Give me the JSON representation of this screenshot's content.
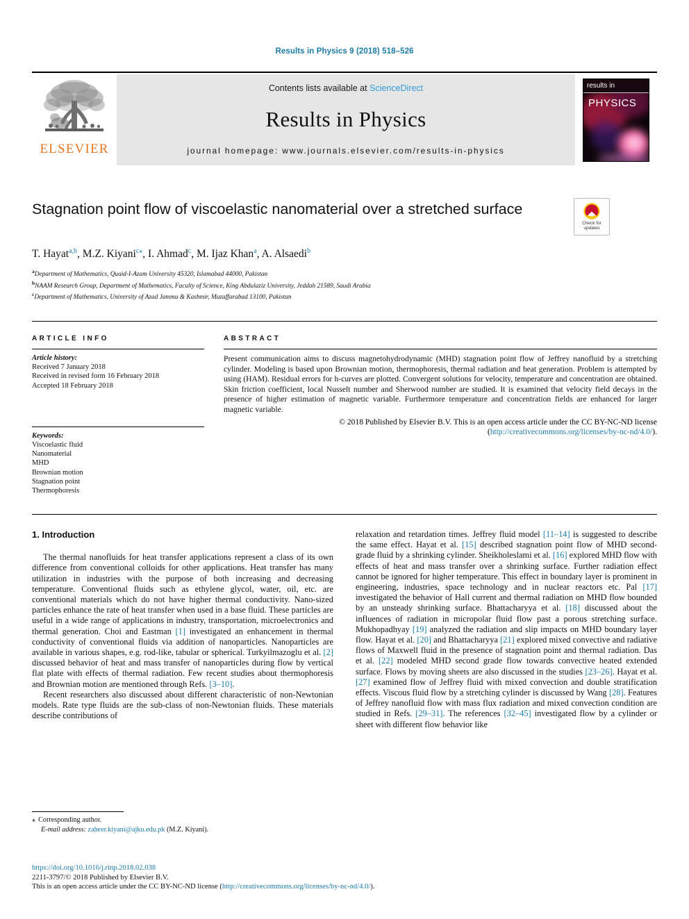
{
  "running_head": "Results in Physics 9 (2018) 518–526",
  "masthead": {
    "publisher_name": "ELSEVIER",
    "contents_prefix": "Contents lists available at ",
    "contents_link": "ScienceDirect",
    "journal_title": "Results in Physics",
    "homepage": "journal homepage: www.journals.elsevier.com/results-in-physics",
    "cover": {
      "line1": "results in",
      "line2": "PHYSICS"
    }
  },
  "article": {
    "title": "Stagnation point flow of viscoelastic nanomaterial over a stretched surface",
    "crossmark_line1": "Check for",
    "crossmark_line2": "updates",
    "authors_html": "T. Hayat<sup>a,b</sup>, M.Z. Kiyani<sup>c</sup><sup class=\"star\">⁎</sup>, I. Ahmad<sup>c</sup>, M. Ijaz Khan<sup>a</sup>, A. Alsaedi<sup>b</sup>",
    "affiliations": [
      {
        "mark": "a",
        "text": "Department of Mathematics, Quaid-I-Azam University 45320, Islamabad 44000, Pakistan"
      },
      {
        "mark": "b",
        "text": "NAAM Research Group, Department of Mathematics, Faculty of Science, King Abdulaziz University, Jeddah 21589, Saudi Arabia"
      },
      {
        "mark": "c",
        "text": "Department of Mathematics, University of Azad Jammu & Kashmir, Muzaffarabad 13100, Pakistan"
      }
    ]
  },
  "article_info": {
    "heading": "ARTICLE INFO",
    "history_label": "Article history:",
    "history": [
      "Received 7 January 2018",
      "Received in revised form 16 February 2018",
      "Accepted 18 February 2018"
    ],
    "keywords_label": "Keywords:",
    "keywords": [
      "Viscoelastic fluid",
      "Nanomaterial",
      "MHD",
      "Brownian motion",
      "Stagnation point",
      "Thermophoresis"
    ]
  },
  "abstract": {
    "heading": "ABSTRACT",
    "body": "Present communication aims to discuss magnetohydrodynamic (MHD) stagnation point flow of Jeffrey nanofluid by a stretching cylinder. Modeling is based upon Brownian motion, thermophoresis, thermal radiation and heat generation. Problem is attempted by using (HAM). Residual errors for h-curves are plotted. Convergent solutions for velocity, temperature and concentration are obtained. Skin friction coefficient, local Nusselt number and Sherwood number are studied. It is examined that velocity field decays in the presence of higher estimation of magnetic variable. Furthermore temperature and concentration fields are enhanced for larger magnetic variable.",
    "copyright_text": "© 2018 Published by Elsevier B.V. This is an open access article under the CC BY-NC-ND license (",
    "license_url": "http://creativecommons.org/licenses/by-nc-nd/4.0/",
    "copyright_tail": ")."
  },
  "body": {
    "section1_heading": "1. Introduction",
    "left_paragraph_1": "The thermal nanofluids for heat transfer applications represent a class of its own difference from conventional colloids for other applications. Heat transfer has many utilization in industries with the purpose of both increasing and decreasing temperature. Conventional fluids such as ethylene glycol, water, oil, etc. are conventional materials which do not have higher thermal conductivity. Nano-sized particles enhance the rate of heat transfer when used in a base fluid. These particles are useful in a wide range of applications in industry, transportation, microelectronics and thermal generation. Choi and Eastman [1] investigated an enhancement in thermal conductivity of conventional fluids via addition of nanoparticles. Nanoparticles are available in various shapes, e.g. rod-like, tabular or spherical. Turkyilmazoglu et al. [2] discussed behavior of heat and mass transfer of nanoparticles during flow by vertical flat plate with effects of thermal radiation. Few recent studies about thermophoresis and Brownian motion are mentioned through Refs. [3–10].",
    "left_paragraph_2": "Recent researchers also discussed about different characteristic of non-Newtonian models. Rate type fluids are the sub-class of non-Newtonian fluids. These materials describe contributions of",
    "right_paragraph_1": "relaxation and retardation times. Jeffrey fluid model [11–14] is suggested to describe the same effect. Hayat et al. [15] described stagnation point flow of MHD second-grade fluid by a shrinking cylinder. Sheikholeslami et al. [16] explored MHD flow with effects of heat and mass transfer over a shrinking surface. Further radiation effect cannot be ignored for higher temperature. This effect in boundary layer is prominent in engineering, industries, space technology and in nuclear reactors etc. Pal [17] investigated the behavior of Hall current and thermal radiation on MHD flow bounded by an unsteady shrinking surface. Bhattacharyya et al. [18] discussed about the influences of radiation in micropolar fluid flow past a porous stretching surface. Mukhopadhyay [19] analyzed the radiation and slip impacts on MHD boundary layer flow. Hayat et al. [20] and Bhattacharyya [21] explored mixed convective and radiative flows of Maxwell fluid in the presence of stagnation point and thermal radiation. Das et al. [22] modeled MHD second grade flow towards convective heated extended surface. Flows by moving sheets are also discussed in the studies [23–26]. Hayat et al. [27] examined flow of Jeffrey fluid with mixed convection and double stratification effects. Viscous fluid flow by a stretching cylinder is discussed by Wang [28]. Features of Jeffrey nanofluid flow with mass flux radiation and mixed convection condition are studied in Refs. [29–31]. The references [32–45] investigated flow by a cylinder or sheet with different flow behavior like"
  },
  "footnote": {
    "star": "⁎",
    "corresponding": "Corresponding author.",
    "email_label": "E-mail address:",
    "email": "zaheer.kiyani@ajku.edu.pk",
    "email_owner": "(M.Z. Kiyani)."
  },
  "footer": {
    "doi": "https://doi.org/10.1016/j.rinp.2018.02.038",
    "issn_line": "2211-3797/© 2018 Published by Elsevier B.V.",
    "license_prefix": "This is an open access article under the CC BY-NC-ND license (",
    "license_url": "http://creativecommons.org/licenses/by-nc-nd/4.0/",
    "license_suffix": ")."
  },
  "colors": {
    "link": "#1a7ba8",
    "sciencedirect": "#2e9bd6",
    "elsevier_orange": "#e87722",
    "band_gray": "#e6e6e6"
  }
}
